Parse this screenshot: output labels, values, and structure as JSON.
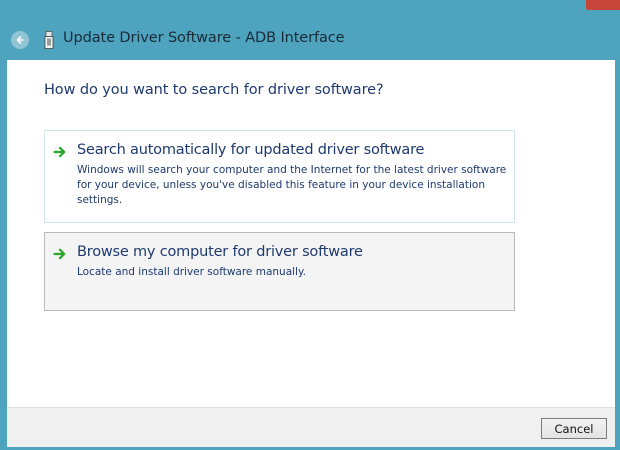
{
  "window": {
    "title": "Update Driver Software - ADB Interface"
  },
  "main": {
    "question": "How do you want to search for driver software?",
    "options": [
      {
        "title": "Search automatically for updated driver software",
        "description": "Windows will search your computer and the Internet for the latest driver software for your device, unless you've disabled this feature in your device installation settings."
      },
      {
        "title": "Browse my computer for driver software",
        "description": "Locate and install driver software manually."
      }
    ]
  },
  "footer": {
    "cancel_label": "Cancel"
  },
  "icons": {
    "back": "back-arrow-icon",
    "device": "usb-device-icon",
    "option_arrow": "green-arrow-icon"
  },
  "colors": {
    "frame": "#4ea3bf",
    "link_text": "#1e3a6e",
    "arrow_green": "#2aa52a",
    "close_button": "#c7453b"
  }
}
